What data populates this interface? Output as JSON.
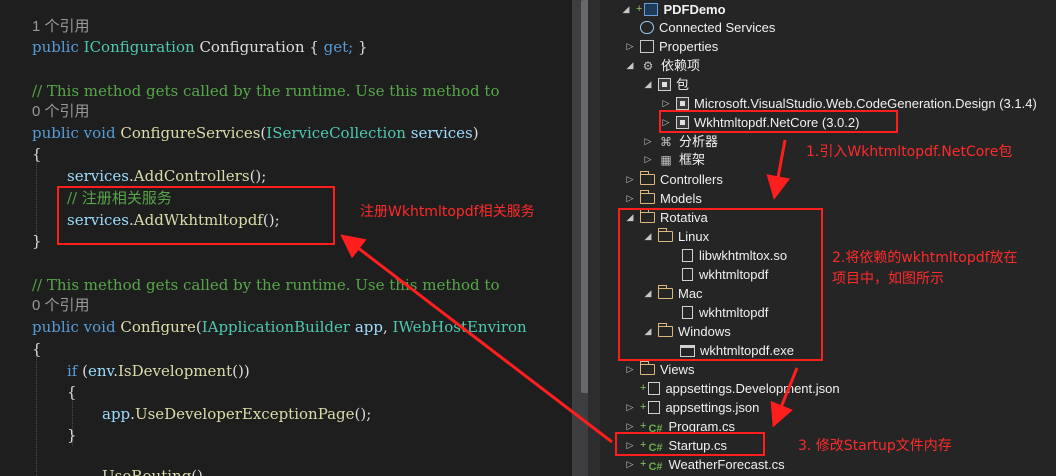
{
  "editor": {
    "lines": {
      "ref1": "1 个引用",
      "config_prop_public": "public",
      "config_prop_type": "IConfiguration",
      "config_prop_name": "Configuration",
      "config_prop_open": "{",
      "config_prop_get": "get;",
      "config_prop_close": "}",
      "comment1": "// This method gets called by the runtime. Use this method to",
      "ref2": "0 个引用",
      "cs_public": "public",
      "cs_void": "void",
      "cs_name": "ConfigureServices",
      "cs_param_type": "IServiceCollection",
      "cs_param_name": "services",
      "open1": "{",
      "add_controllers_obj": "services",
      "add_controllers_call": "AddControllers",
      "comment_register": "// 注册相关服务",
      "add_wk_obj": "services",
      "add_wk_call": "AddWkhtmltopdf",
      "close1": "}",
      "comment2": "// This method gets called by the runtime. Use this method to",
      "ref3": "0 个引用",
      "c_public": "public",
      "c_void": "void",
      "c_name": "Configure",
      "c_param1_type": "IApplicationBuilder",
      "c_param1_name": "app",
      "c_param2_type": "IWebHostEnviron",
      "open2": "{",
      "if_kw": "if",
      "if_obj": "env",
      "if_call": "IsDevelopment",
      "open3": "{",
      "app_obj": "app",
      "app_call": "UseDeveloperExceptionPage",
      "close3": "}",
      "use_routing": "UseRouting"
    }
  },
  "explorer": {
    "project": "PDFDemo",
    "connected_services": "Connected Services",
    "properties": "Properties",
    "dependencies": "依赖项",
    "packages": "包",
    "pkg1_name": "Microsoft.VisualStudio.Web.CodeGeneration.Design",
    "pkg1_ver": "(3.1.4)",
    "pkg2_name": "Wkhtmltopdf.NetCore",
    "pkg2_ver": "(3.0.2)",
    "analyzers": "分析器",
    "frameworks": "框架",
    "controllers": "Controllers",
    "models": "Models",
    "rotativa": "Rotativa",
    "linux": "Linux",
    "linux_file1": "libwkhtmltox.so",
    "linux_file2": "wkhtmltopdf",
    "mac": "Mac",
    "mac_file": "wkhtmltopdf",
    "windows": "Windows",
    "windows_file": "wkhtmltopdf.exe",
    "views": "Views",
    "appsettings_dev": "appsettings.Development.json",
    "appsettings": "appsettings.json",
    "program": "Program.cs",
    "startup": "Startup.cs",
    "weather": "WeatherForecast.cs",
    "cs_badge": "C#"
  },
  "annotations": {
    "register_service": "注册Wkhtmltopdf相关服务",
    "step1": "1.引入Wkhtmltopdf.NetCore包",
    "step2_line1": "2.将依赖的wkhtmltopdf放在",
    "step2_line2": "项目中，如图所示",
    "step3": "3. 修改Startup文件内存"
  },
  "colors": {
    "annotation_red": "#ff1e1e",
    "editor_bg": "#1e1e1e",
    "explorer_bg": "#252526"
  }
}
